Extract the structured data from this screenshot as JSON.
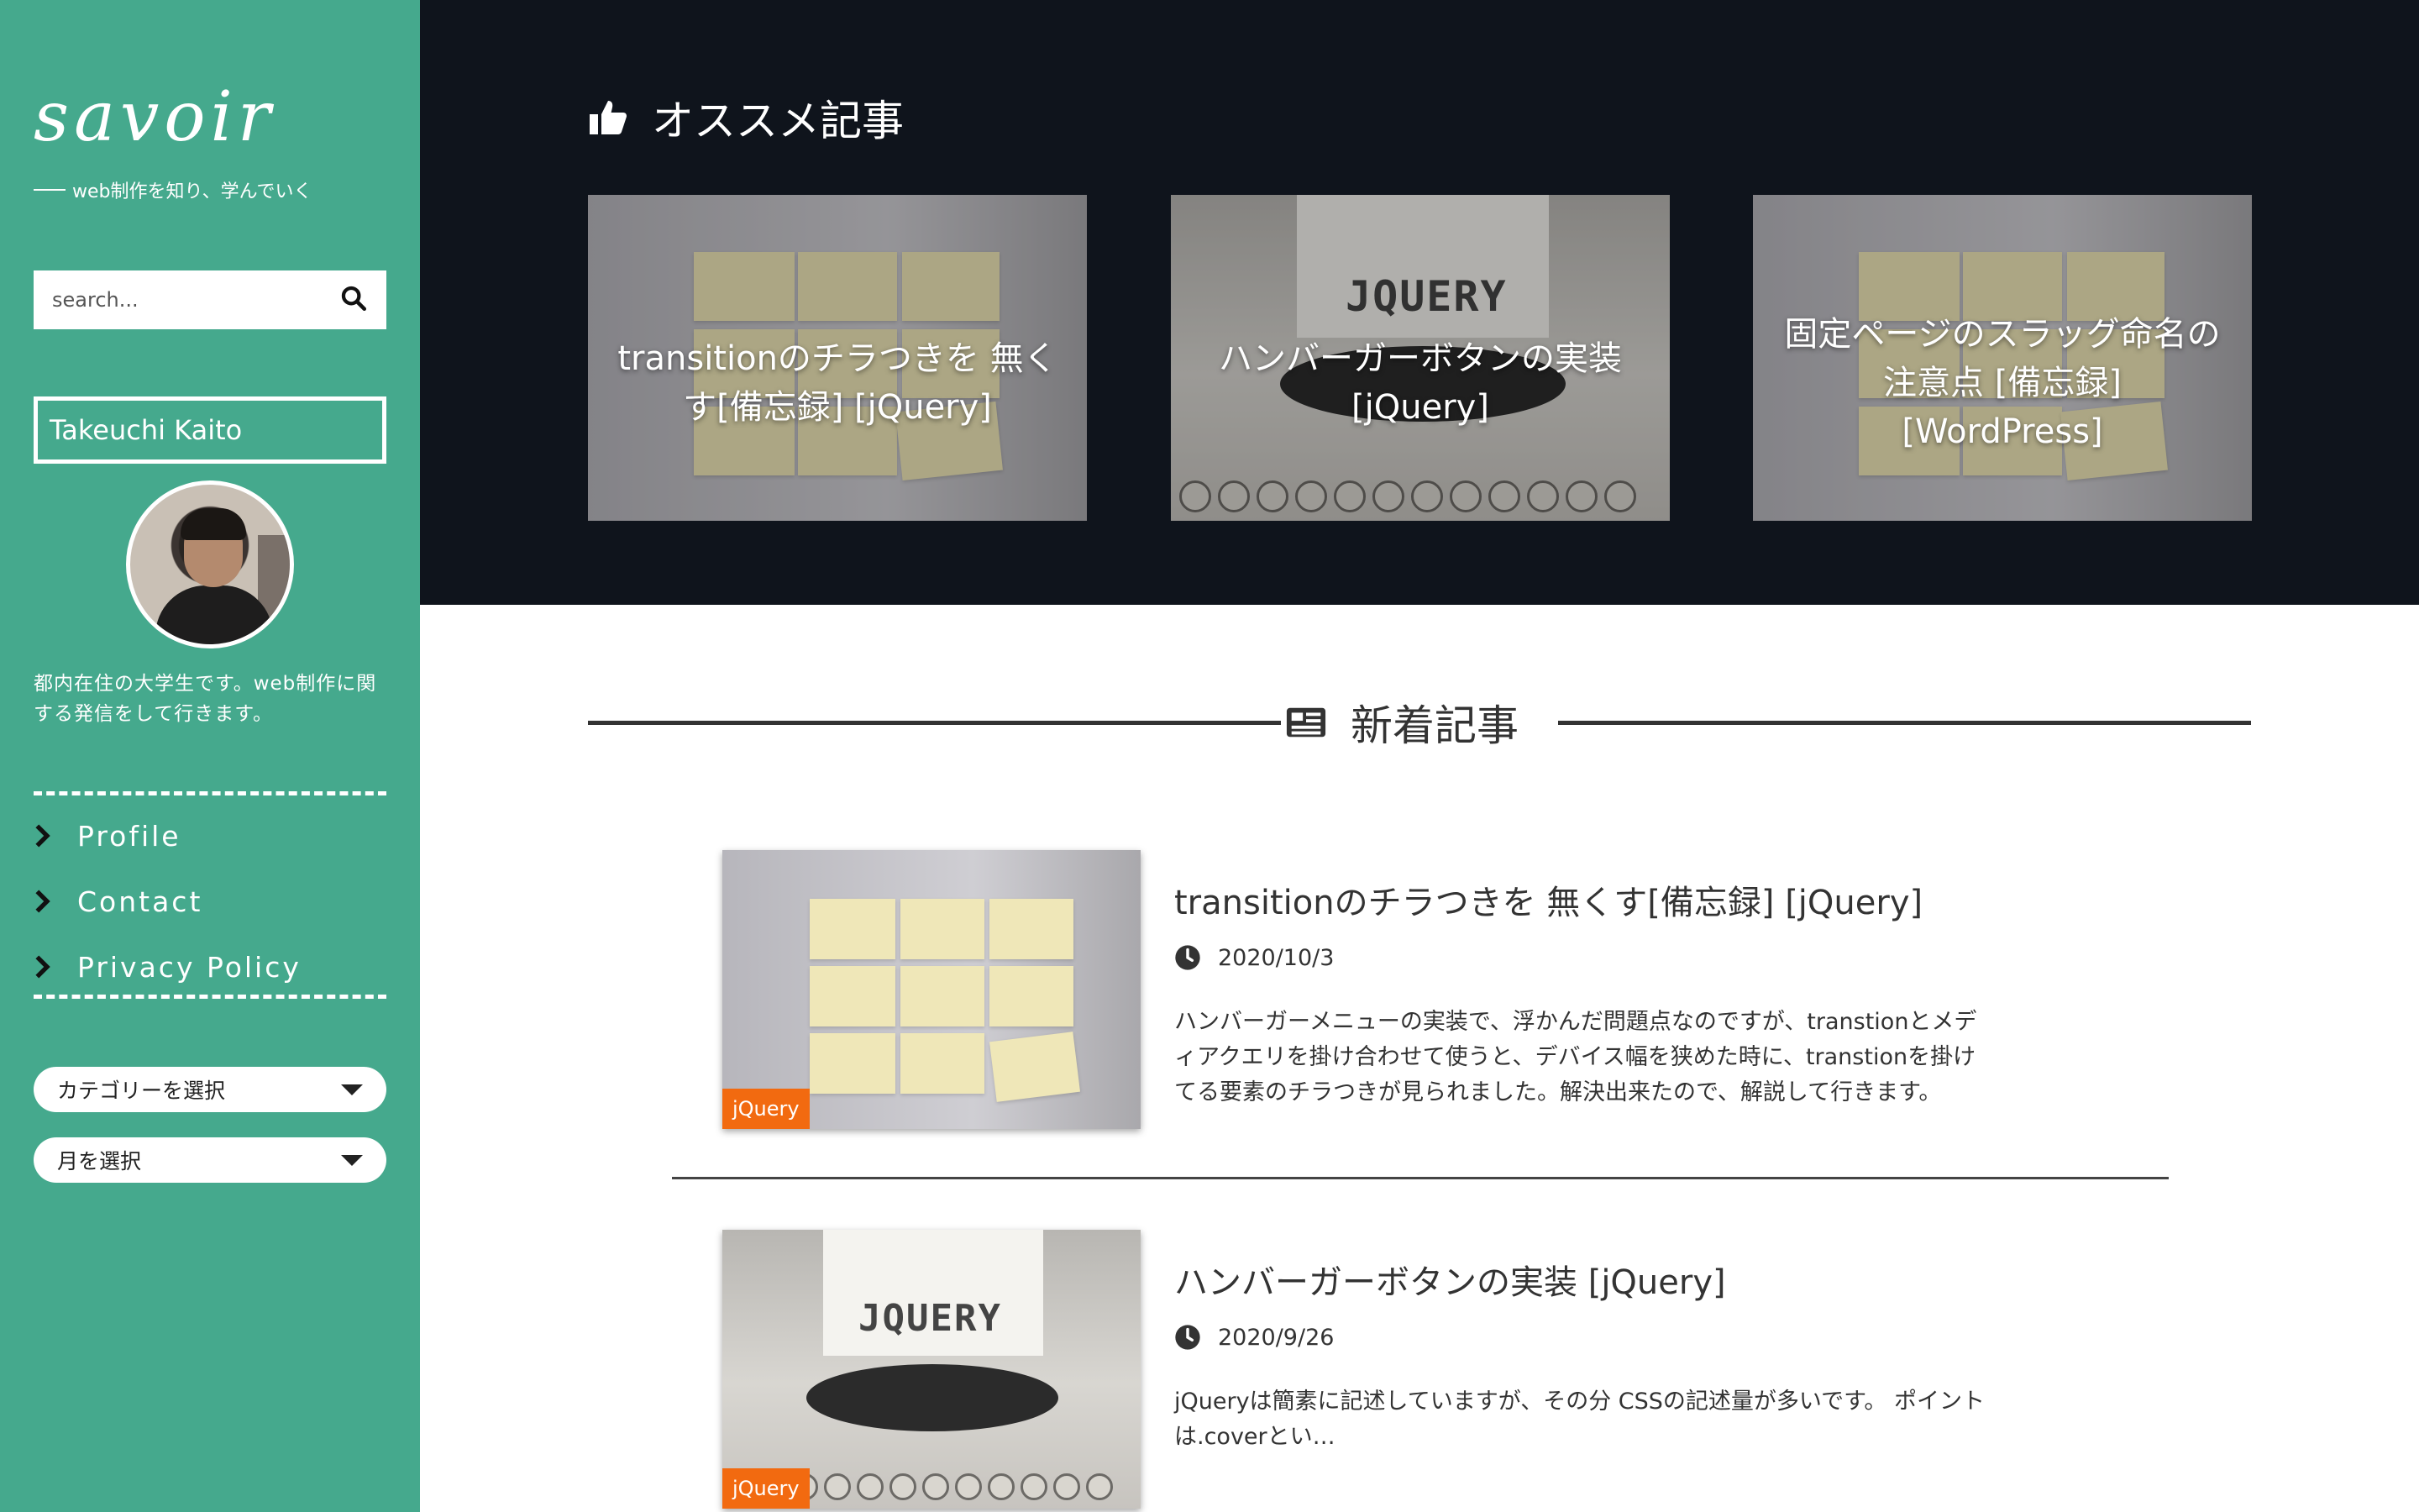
{
  "sidebar": {
    "logo": "savoir",
    "tagline": "web制作を知り、学んでいく",
    "search_placeholder": "search...",
    "author_name": "Takeuchi Kaito",
    "bio": "都内在住の大学生です。web制作に関する発信をして行きます。",
    "nav": [
      {
        "label": "Profile"
      },
      {
        "label": "Contact"
      },
      {
        "label": "Privacy Policy"
      }
    ],
    "category_select": "カテゴリーを選択",
    "month_select": "月を選択"
  },
  "featured": {
    "heading": "オススメ記事",
    "cards": [
      {
        "title": "transitionのチラつきを 無くす[備忘録] [jQuery]"
      },
      {
        "title": "ハンバーガーボタンの実装 [jQuery]",
        "image_text": "JQUERY"
      },
      {
        "title": "固定ページのスラッグ命名の注意点 [備忘録] [WordPress]"
      }
    ]
  },
  "new_posts": {
    "heading": "新着記事",
    "posts": [
      {
        "title": "transitionのチラつきを 無くす[備忘録] [jQuery]",
        "date": "2020/10/3",
        "tag": "jQuery",
        "excerpt_lines": [
          "ハンバーガーメニューの実装で、浮かんだ問題点なのですが、transtionとメデ",
          "ィアクエリを掛け合わせて使うと、デバイス幅を狭めた時に、transtionを掛け",
          "てる要素のチラつきが見られました。解決出来たので、解説して行きます。"
        ]
      },
      {
        "title": "ハンバーガーボタンの実装 [jQuery]",
        "date": "2020/9/26",
        "tag": "jQuery",
        "image_text": "JQUERY",
        "excerpt_lines": [
          "jQueryは簡素に記述していますが、その分 CSSの記述量が多いです。 ポイント",
          "は.coverとい…"
        ]
      }
    ]
  },
  "colors": {
    "sidebar_bg": "#45a98d",
    "featured_bg": "#0f141c",
    "tag_bg": "#f26a10"
  }
}
